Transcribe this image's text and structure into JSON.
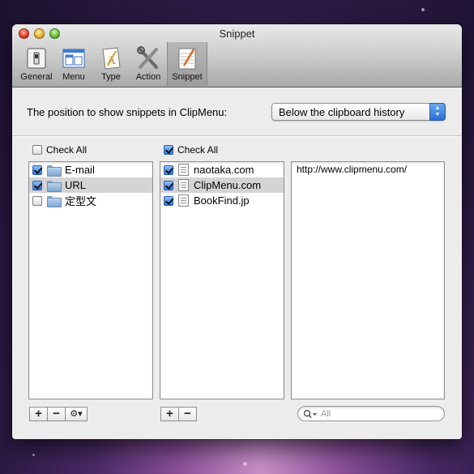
{
  "window": {
    "title": "Snippet"
  },
  "toolbar": {
    "tabs": [
      {
        "label": "General",
        "icon": "switch-icon"
      },
      {
        "label": "Menu",
        "icon": "menu-icon"
      },
      {
        "label": "Type",
        "icon": "type-icon"
      },
      {
        "label": "Action",
        "icon": "tools-icon"
      },
      {
        "label": "Snippet",
        "icon": "notepad-icon",
        "selected": true
      }
    ]
  },
  "position": {
    "label": "The position to show snippets in ClipMenu:",
    "selected": "Below the clipboard history"
  },
  "folders": {
    "check_all_label": "Check All",
    "check_all": false,
    "items": [
      {
        "label": "E-mail",
        "checked": true,
        "selected": false
      },
      {
        "label": "URL",
        "checked": true,
        "selected": true
      },
      {
        "label": "定型文",
        "checked": false,
        "selected": false
      }
    ]
  },
  "snippets": {
    "check_all_label": "Check All",
    "check_all": true,
    "items": [
      {
        "label": "naotaka.com",
        "checked": true,
        "selected": false
      },
      {
        "label": "ClipMenu.com",
        "checked": true,
        "selected": true
      },
      {
        "label": "BookFind.jp",
        "checked": true,
        "selected": false
      }
    ]
  },
  "detail": {
    "content": "http://www.clipmenu.com/"
  },
  "buttons": {
    "add": "+",
    "remove": "−",
    "gear": "⚙▾"
  },
  "search": {
    "placeholder": "All"
  },
  "colors": {
    "accent": "#2f78dc",
    "selection": "#d4d4d4"
  }
}
